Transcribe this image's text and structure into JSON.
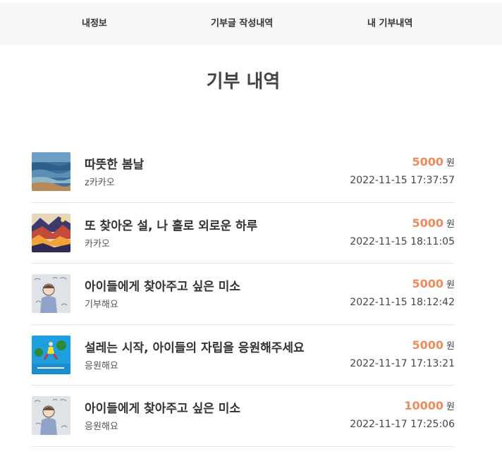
{
  "nav": {
    "tabs": [
      {
        "label": "내정보"
      },
      {
        "label": "기부글 작성내역"
      },
      {
        "label": "내 기부내역"
      }
    ]
  },
  "page": {
    "title": "기부 내역"
  },
  "donations": [
    {
      "title": "따뜻한 봄날",
      "author": "z카카오",
      "amount": "5000",
      "unit": "원",
      "date": "2022-11-15 17:37:57",
      "thumb": "sea-painting-thumbnail"
    },
    {
      "title": "또 찾아온 설, 나 홀로 외로운 하루",
      "author": "카카오",
      "amount": "5000",
      "unit": "원",
      "date": "2022-11-15 18:11:05",
      "thumb": "mountain-art-thumbnail"
    },
    {
      "title": "아이들에게 찾아주고 싶은 미소",
      "author": "기부해요",
      "amount": "5000",
      "unit": "원",
      "date": "2022-11-15 18:12:42",
      "thumb": "sad-child-illustration-thumbnail"
    },
    {
      "title": "설레는 시작, 아이들의 자립을 응원해주세요",
      "author": "응원해요",
      "amount": "5000",
      "unit": "원",
      "date": "2022-11-17 17:13:21",
      "thumb": "running-child-poster-thumbnail"
    },
    {
      "title": "아이들에게 찾아주고 싶은 미소",
      "author": "응원해요",
      "amount": "10000",
      "unit": "원",
      "date": "2022-11-17 17:25:06",
      "thumb": "sad-child-illustration-thumbnail"
    }
  ],
  "colors": {
    "amount": "#f08a5d",
    "nav_bg": "#f5f6f7",
    "divider": "#e4e4e4"
  }
}
